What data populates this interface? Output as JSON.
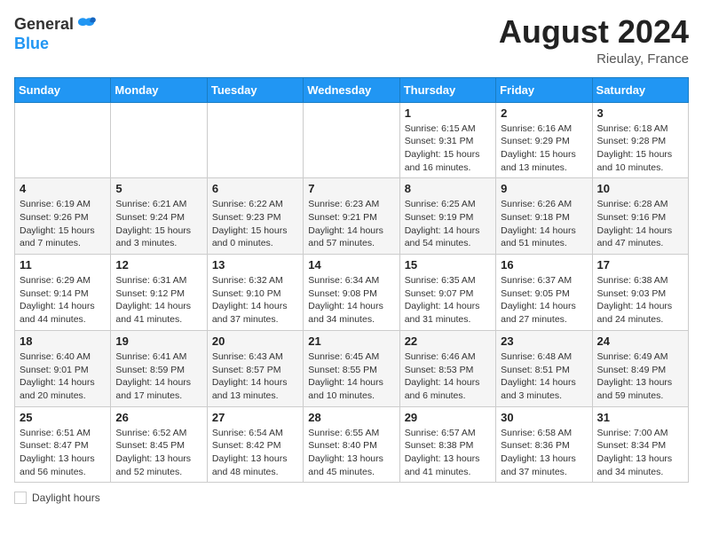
{
  "header": {
    "logo_general": "General",
    "logo_blue": "Blue",
    "month_year": "August 2024",
    "location": "Rieulay, France"
  },
  "weekdays": [
    "Sunday",
    "Monday",
    "Tuesday",
    "Wednesday",
    "Thursday",
    "Friday",
    "Saturday"
  ],
  "legend": {
    "label": "Daylight hours"
  },
  "weeks": [
    [
      {
        "day": "",
        "info": ""
      },
      {
        "day": "",
        "info": ""
      },
      {
        "day": "",
        "info": ""
      },
      {
        "day": "",
        "info": ""
      },
      {
        "day": "1",
        "info": "Sunrise: 6:15 AM\nSunset: 9:31 PM\nDaylight: 15 hours and 16 minutes."
      },
      {
        "day": "2",
        "info": "Sunrise: 6:16 AM\nSunset: 9:29 PM\nDaylight: 15 hours and 13 minutes."
      },
      {
        "day": "3",
        "info": "Sunrise: 6:18 AM\nSunset: 9:28 PM\nDaylight: 15 hours and 10 minutes."
      }
    ],
    [
      {
        "day": "4",
        "info": "Sunrise: 6:19 AM\nSunset: 9:26 PM\nDaylight: 15 hours and 7 minutes."
      },
      {
        "day": "5",
        "info": "Sunrise: 6:21 AM\nSunset: 9:24 PM\nDaylight: 15 hours and 3 minutes."
      },
      {
        "day": "6",
        "info": "Sunrise: 6:22 AM\nSunset: 9:23 PM\nDaylight: 15 hours and 0 minutes."
      },
      {
        "day": "7",
        "info": "Sunrise: 6:23 AM\nSunset: 9:21 PM\nDaylight: 14 hours and 57 minutes."
      },
      {
        "day": "8",
        "info": "Sunrise: 6:25 AM\nSunset: 9:19 PM\nDaylight: 14 hours and 54 minutes."
      },
      {
        "day": "9",
        "info": "Sunrise: 6:26 AM\nSunset: 9:18 PM\nDaylight: 14 hours and 51 minutes."
      },
      {
        "day": "10",
        "info": "Sunrise: 6:28 AM\nSunset: 9:16 PM\nDaylight: 14 hours and 47 minutes."
      }
    ],
    [
      {
        "day": "11",
        "info": "Sunrise: 6:29 AM\nSunset: 9:14 PM\nDaylight: 14 hours and 44 minutes."
      },
      {
        "day": "12",
        "info": "Sunrise: 6:31 AM\nSunset: 9:12 PM\nDaylight: 14 hours and 41 minutes."
      },
      {
        "day": "13",
        "info": "Sunrise: 6:32 AM\nSunset: 9:10 PM\nDaylight: 14 hours and 37 minutes."
      },
      {
        "day": "14",
        "info": "Sunrise: 6:34 AM\nSunset: 9:08 PM\nDaylight: 14 hours and 34 minutes."
      },
      {
        "day": "15",
        "info": "Sunrise: 6:35 AM\nSunset: 9:07 PM\nDaylight: 14 hours and 31 minutes."
      },
      {
        "day": "16",
        "info": "Sunrise: 6:37 AM\nSunset: 9:05 PM\nDaylight: 14 hours and 27 minutes."
      },
      {
        "day": "17",
        "info": "Sunrise: 6:38 AM\nSunset: 9:03 PM\nDaylight: 14 hours and 24 minutes."
      }
    ],
    [
      {
        "day": "18",
        "info": "Sunrise: 6:40 AM\nSunset: 9:01 PM\nDaylight: 14 hours and 20 minutes."
      },
      {
        "day": "19",
        "info": "Sunrise: 6:41 AM\nSunset: 8:59 PM\nDaylight: 14 hours and 17 minutes."
      },
      {
        "day": "20",
        "info": "Sunrise: 6:43 AM\nSunset: 8:57 PM\nDaylight: 14 hours and 13 minutes."
      },
      {
        "day": "21",
        "info": "Sunrise: 6:45 AM\nSunset: 8:55 PM\nDaylight: 14 hours and 10 minutes."
      },
      {
        "day": "22",
        "info": "Sunrise: 6:46 AM\nSunset: 8:53 PM\nDaylight: 14 hours and 6 minutes."
      },
      {
        "day": "23",
        "info": "Sunrise: 6:48 AM\nSunset: 8:51 PM\nDaylight: 14 hours and 3 minutes."
      },
      {
        "day": "24",
        "info": "Sunrise: 6:49 AM\nSunset: 8:49 PM\nDaylight: 13 hours and 59 minutes."
      }
    ],
    [
      {
        "day": "25",
        "info": "Sunrise: 6:51 AM\nSunset: 8:47 PM\nDaylight: 13 hours and 56 minutes."
      },
      {
        "day": "26",
        "info": "Sunrise: 6:52 AM\nSunset: 8:45 PM\nDaylight: 13 hours and 52 minutes."
      },
      {
        "day": "27",
        "info": "Sunrise: 6:54 AM\nSunset: 8:42 PM\nDaylight: 13 hours and 48 minutes."
      },
      {
        "day": "28",
        "info": "Sunrise: 6:55 AM\nSunset: 8:40 PM\nDaylight: 13 hours and 45 minutes."
      },
      {
        "day": "29",
        "info": "Sunrise: 6:57 AM\nSunset: 8:38 PM\nDaylight: 13 hours and 41 minutes."
      },
      {
        "day": "30",
        "info": "Sunrise: 6:58 AM\nSunset: 8:36 PM\nDaylight: 13 hours and 37 minutes."
      },
      {
        "day": "31",
        "info": "Sunrise: 7:00 AM\nSunset: 8:34 PM\nDaylight: 13 hours and 34 minutes."
      }
    ]
  ]
}
